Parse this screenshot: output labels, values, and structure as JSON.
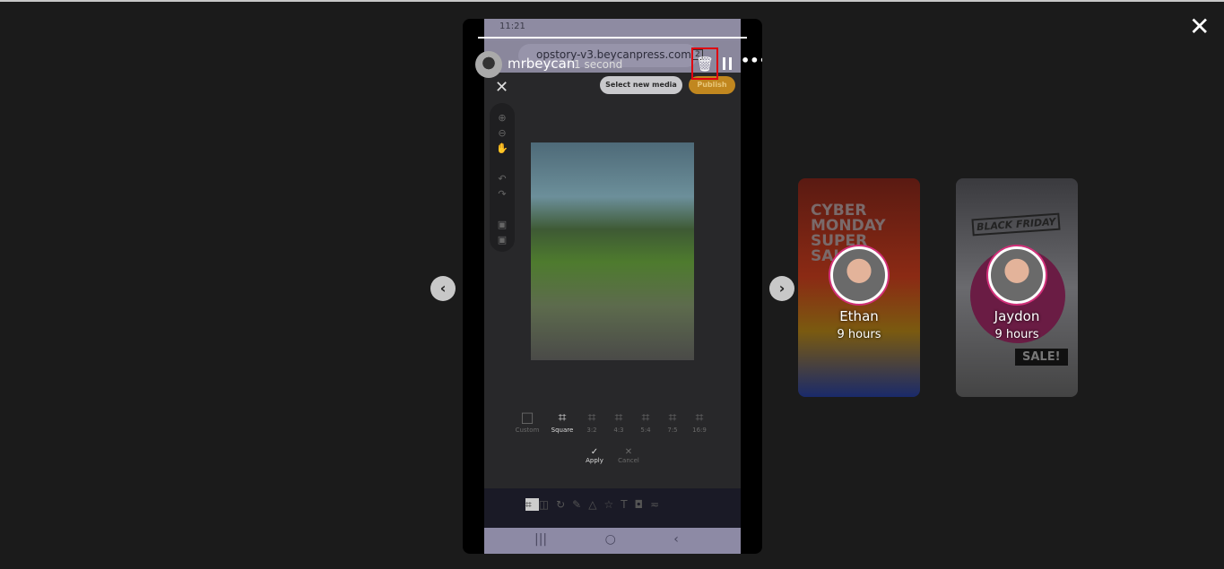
{
  "viewer": {
    "close_icon": "close-icon",
    "prev_icon": "chevron-left-icon",
    "next_icon": "chevron-right-icon",
    "progress": 1.0
  },
  "story": {
    "username": "mrbeycan",
    "time": "1 second",
    "actions": [
      "trash-icon",
      "pause-icon",
      "more-icon"
    ]
  },
  "screenshot": {
    "status_time": "11:21",
    "url": "opstory-v3.beycanpress.com",
    "tab_count": "2",
    "select_media": "Select new media",
    "publish": "Publish",
    "ratios": [
      {
        "label": "Custom",
        "active": false
      },
      {
        "label": "Square",
        "active": true
      },
      {
        "label": "3:2",
        "active": false
      },
      {
        "label": "4:3",
        "active": false
      },
      {
        "label": "5:4",
        "active": false
      },
      {
        "label": "7:5",
        "active": false
      },
      {
        "label": "16:9",
        "active": false
      }
    ],
    "apply": "Apply",
    "cancel": "Cancel"
  },
  "cards": [
    {
      "name": "Ethan",
      "time": "9 hours",
      "bg_lines": [
        "CYBER",
        "MONDAY",
        "SUPER",
        "SALE"
      ]
    },
    {
      "name": "Jaydon",
      "time": "9 hours",
      "bg_lines": [
        "BLACK FRIDAY",
        "SALE!"
      ]
    }
  ],
  "colors": {
    "highlight": "#e0000f",
    "avatar_ring": "#d3307a",
    "publish": "#c1871f"
  }
}
